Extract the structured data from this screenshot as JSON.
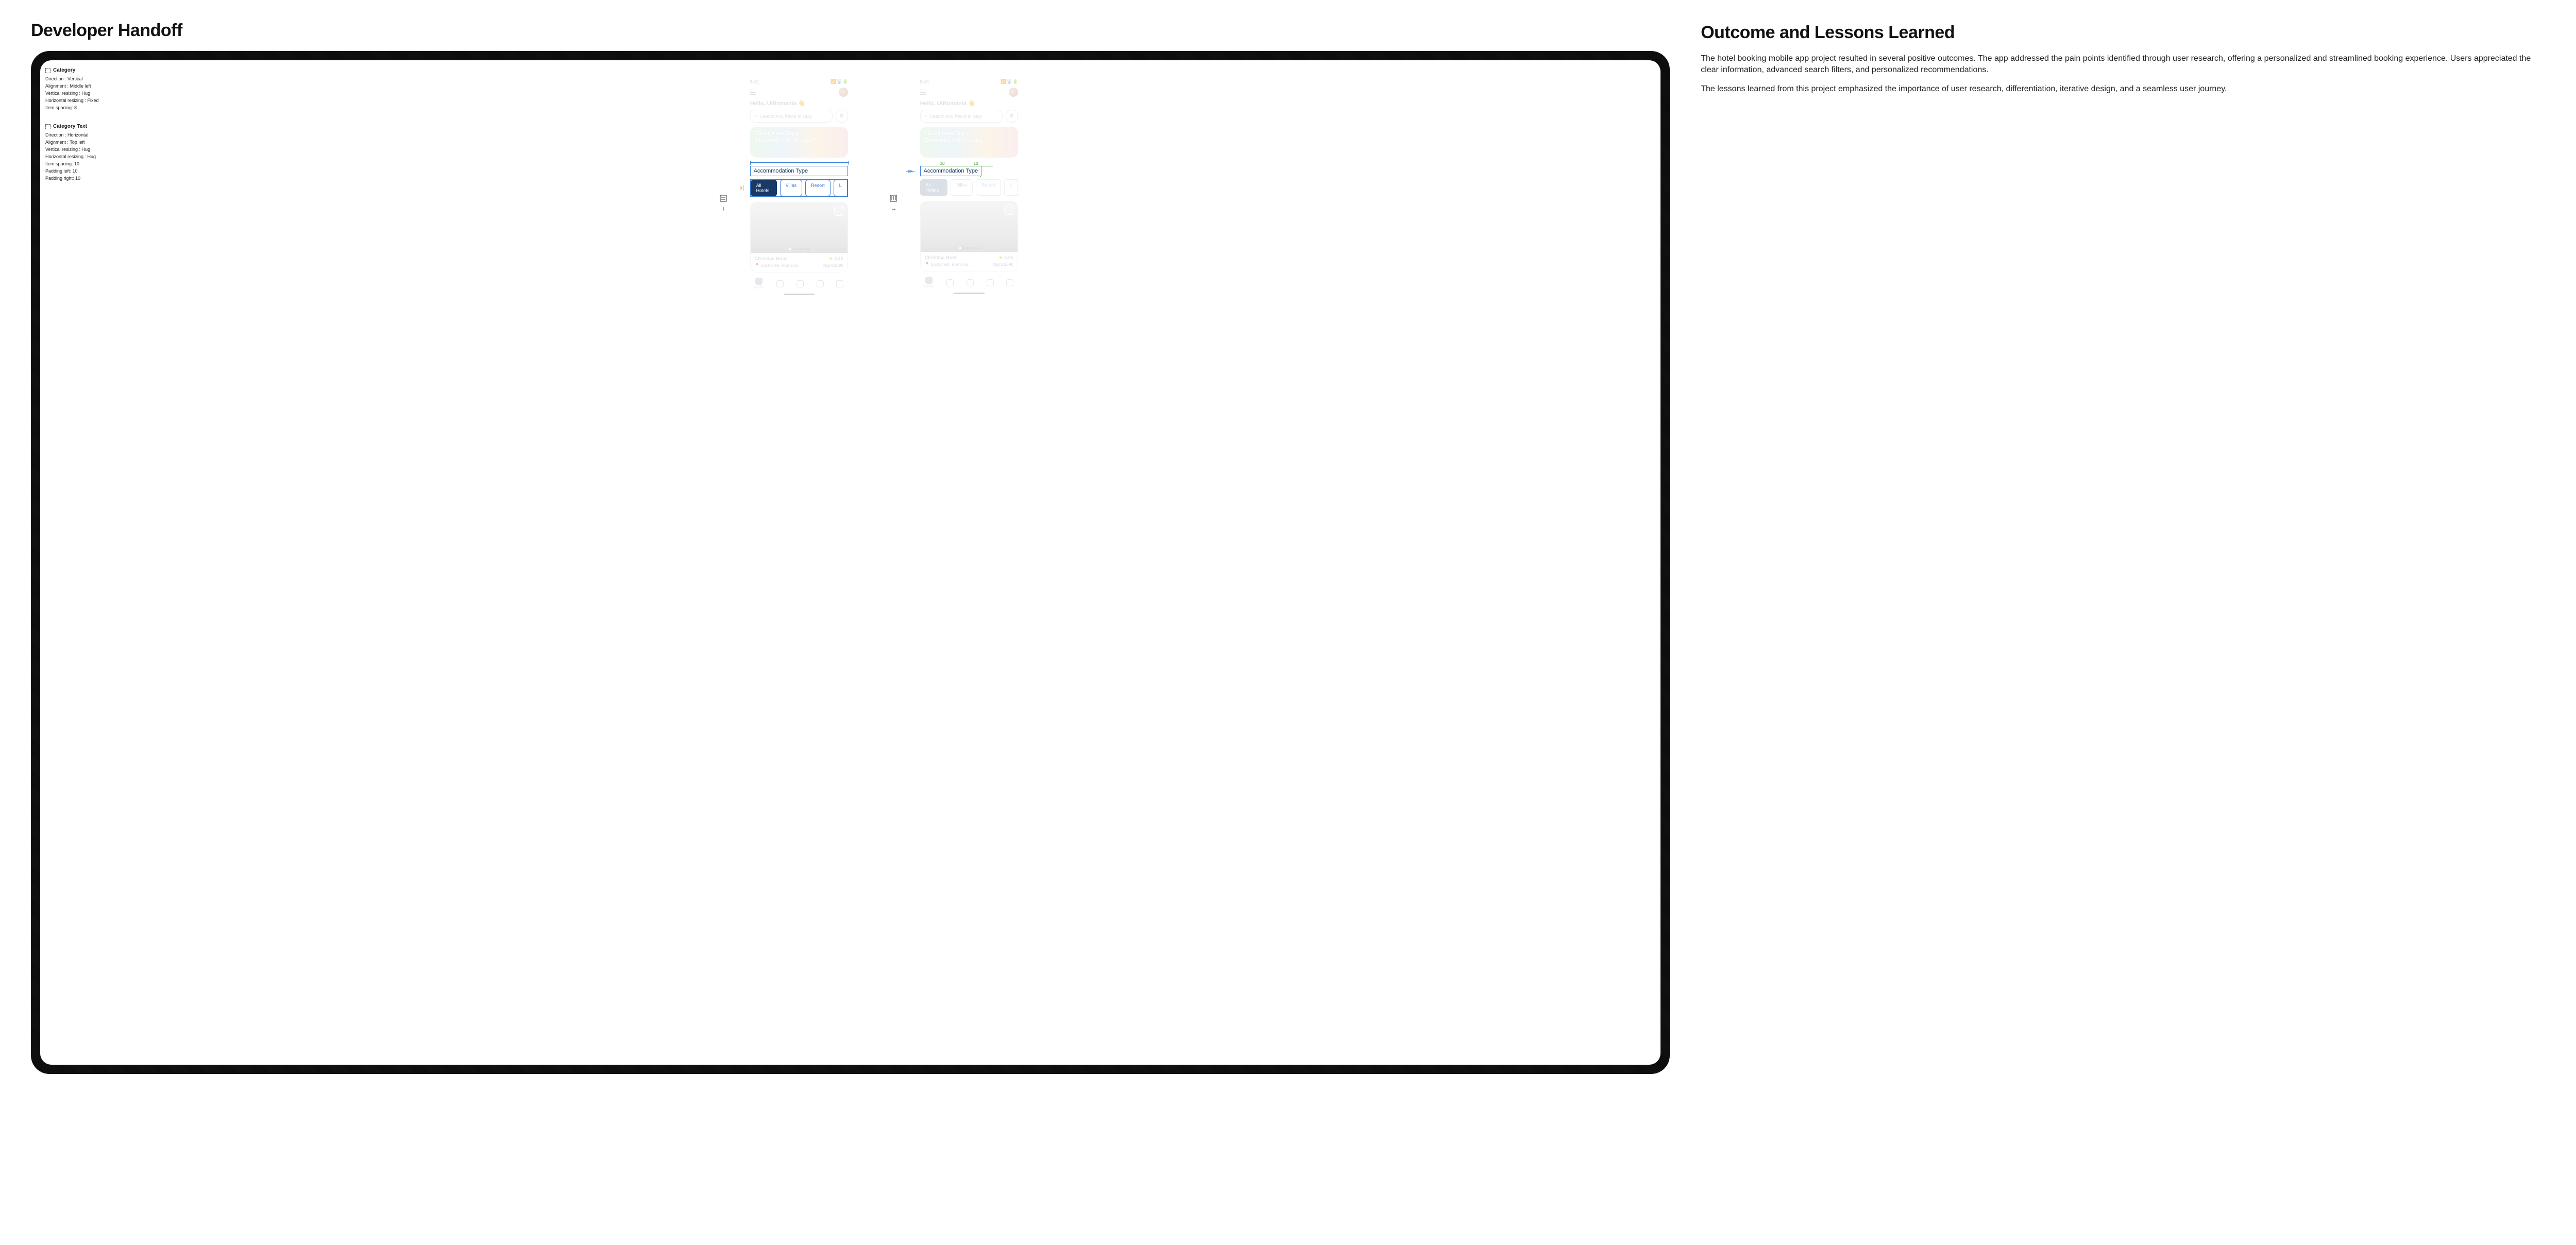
{
  "section_left_title": "Developer Handoff",
  "section_right_title": "Outcome and Lessons Learned",
  "paragraph1": "The hotel booking mobile app project resulted in several positive outcomes. The app addressed the pain points identified through user research, offering a personalized and streamlined booking experience. Users appreciated the clear information, advanced search filters, and personalized recommendations.",
  "paragraph2": "The lessons learned from this project emphasized the importance of user research, differentiation, iterative design, and a seamless user journey.",
  "inspector": {
    "category": {
      "title": "Category",
      "rows": [
        "Direction : Vertical",
        "Alignment : Middle left",
        "Vertical resizing : Hug",
        "Horizontal resizing : Fixed",
        "Item spacing: 8"
      ]
    },
    "category_text": {
      "title": "Category Text",
      "rows": [
        "Direction : Horizontal",
        "Alignment : Top left",
        "Vertical resizing : Hug",
        "Horizontal resizing : Hug",
        "Item spacing: 10",
        "Padding left: 10",
        "Padding right: 10"
      ]
    }
  },
  "measurements": {
    "left_gap": "8",
    "right_padding_left": "10",
    "right_padding_right": "10"
  },
  "phone": {
    "time": "9:41",
    "greeting": "Hello, UIRomania 👋",
    "search_placeholder": "Search Any Place to Stay",
    "promo_line1": "\"Book Now, Enjoy",
    "promo_line2": "Discounts with our app!\"",
    "accommodation_label": "Accommodation Type",
    "chips": [
      "All Hotels",
      "Villas",
      "Resort",
      "L"
    ],
    "hotel": {
      "name": "Christina Hotel",
      "rating": "4.2k",
      "location": "Bucharest, Romania",
      "price_word": "Night",
      "price": "209€"
    },
    "tabs": [
      "Home",
      "",
      "",
      "",
      ""
    ],
    "tab_selected_label": "Home"
  }
}
